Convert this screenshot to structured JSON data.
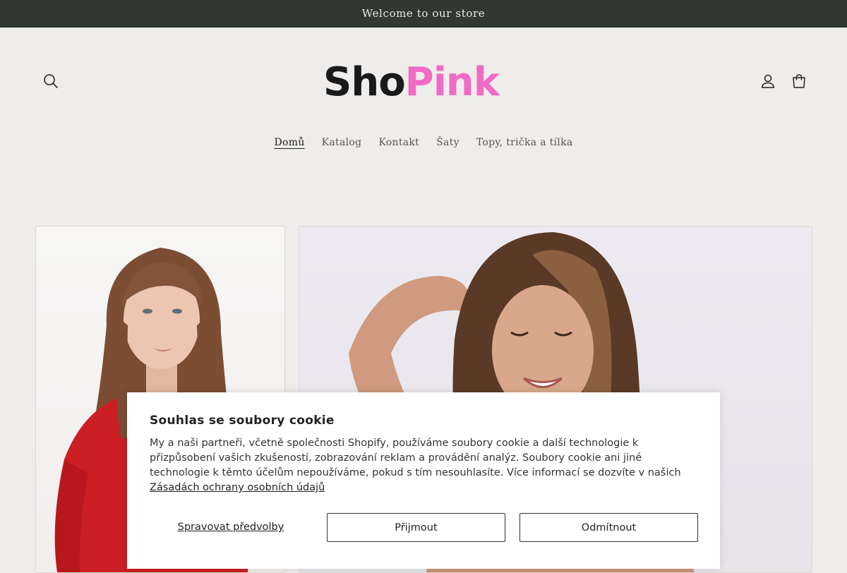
{
  "announcement": {
    "text": "Welcome to our store"
  },
  "header": {
    "logo": {
      "part1": "Sho",
      "part2": "Pink"
    },
    "icons": {
      "search": "search-icon",
      "account": "user-icon",
      "cart": "cart-icon"
    }
  },
  "nav": {
    "items": [
      {
        "label": "Domů",
        "active": true
      },
      {
        "label": "Katalog"
      },
      {
        "label": "Kontakt"
      },
      {
        "label": "Šaty"
      },
      {
        "label": "Topy, trička a tílka"
      }
    ]
  },
  "products": [
    {
      "subject": "woman in red long-sleeve top"
    },
    {
      "subject": "smiling woman with hand behind head"
    }
  ],
  "cookie_banner": {
    "title": "Souhlas se soubory cookie",
    "body": "My a naši partneři, včetně společnosti Shopify, používáme soubory cookie a další technologie k přizpůsobení vašich zkušeností, zobrazování reklam a provádění analýz. Soubory cookie ani jiné technologie k těmto účelům nepoužíváme, pokud s tím nesouhlasíte. Více informací se dozvíte v našich",
    "policy_link": "Zásadách ochrany osobních údajů",
    "manage_label": "Spravovat předvolby",
    "accept_label": "Přijmout",
    "decline_label": "Odmítnout"
  },
  "colors": {
    "announcement_bg": "#2f3833",
    "page_bg": "#efedeb",
    "logo_pink": "#f06bc3"
  }
}
